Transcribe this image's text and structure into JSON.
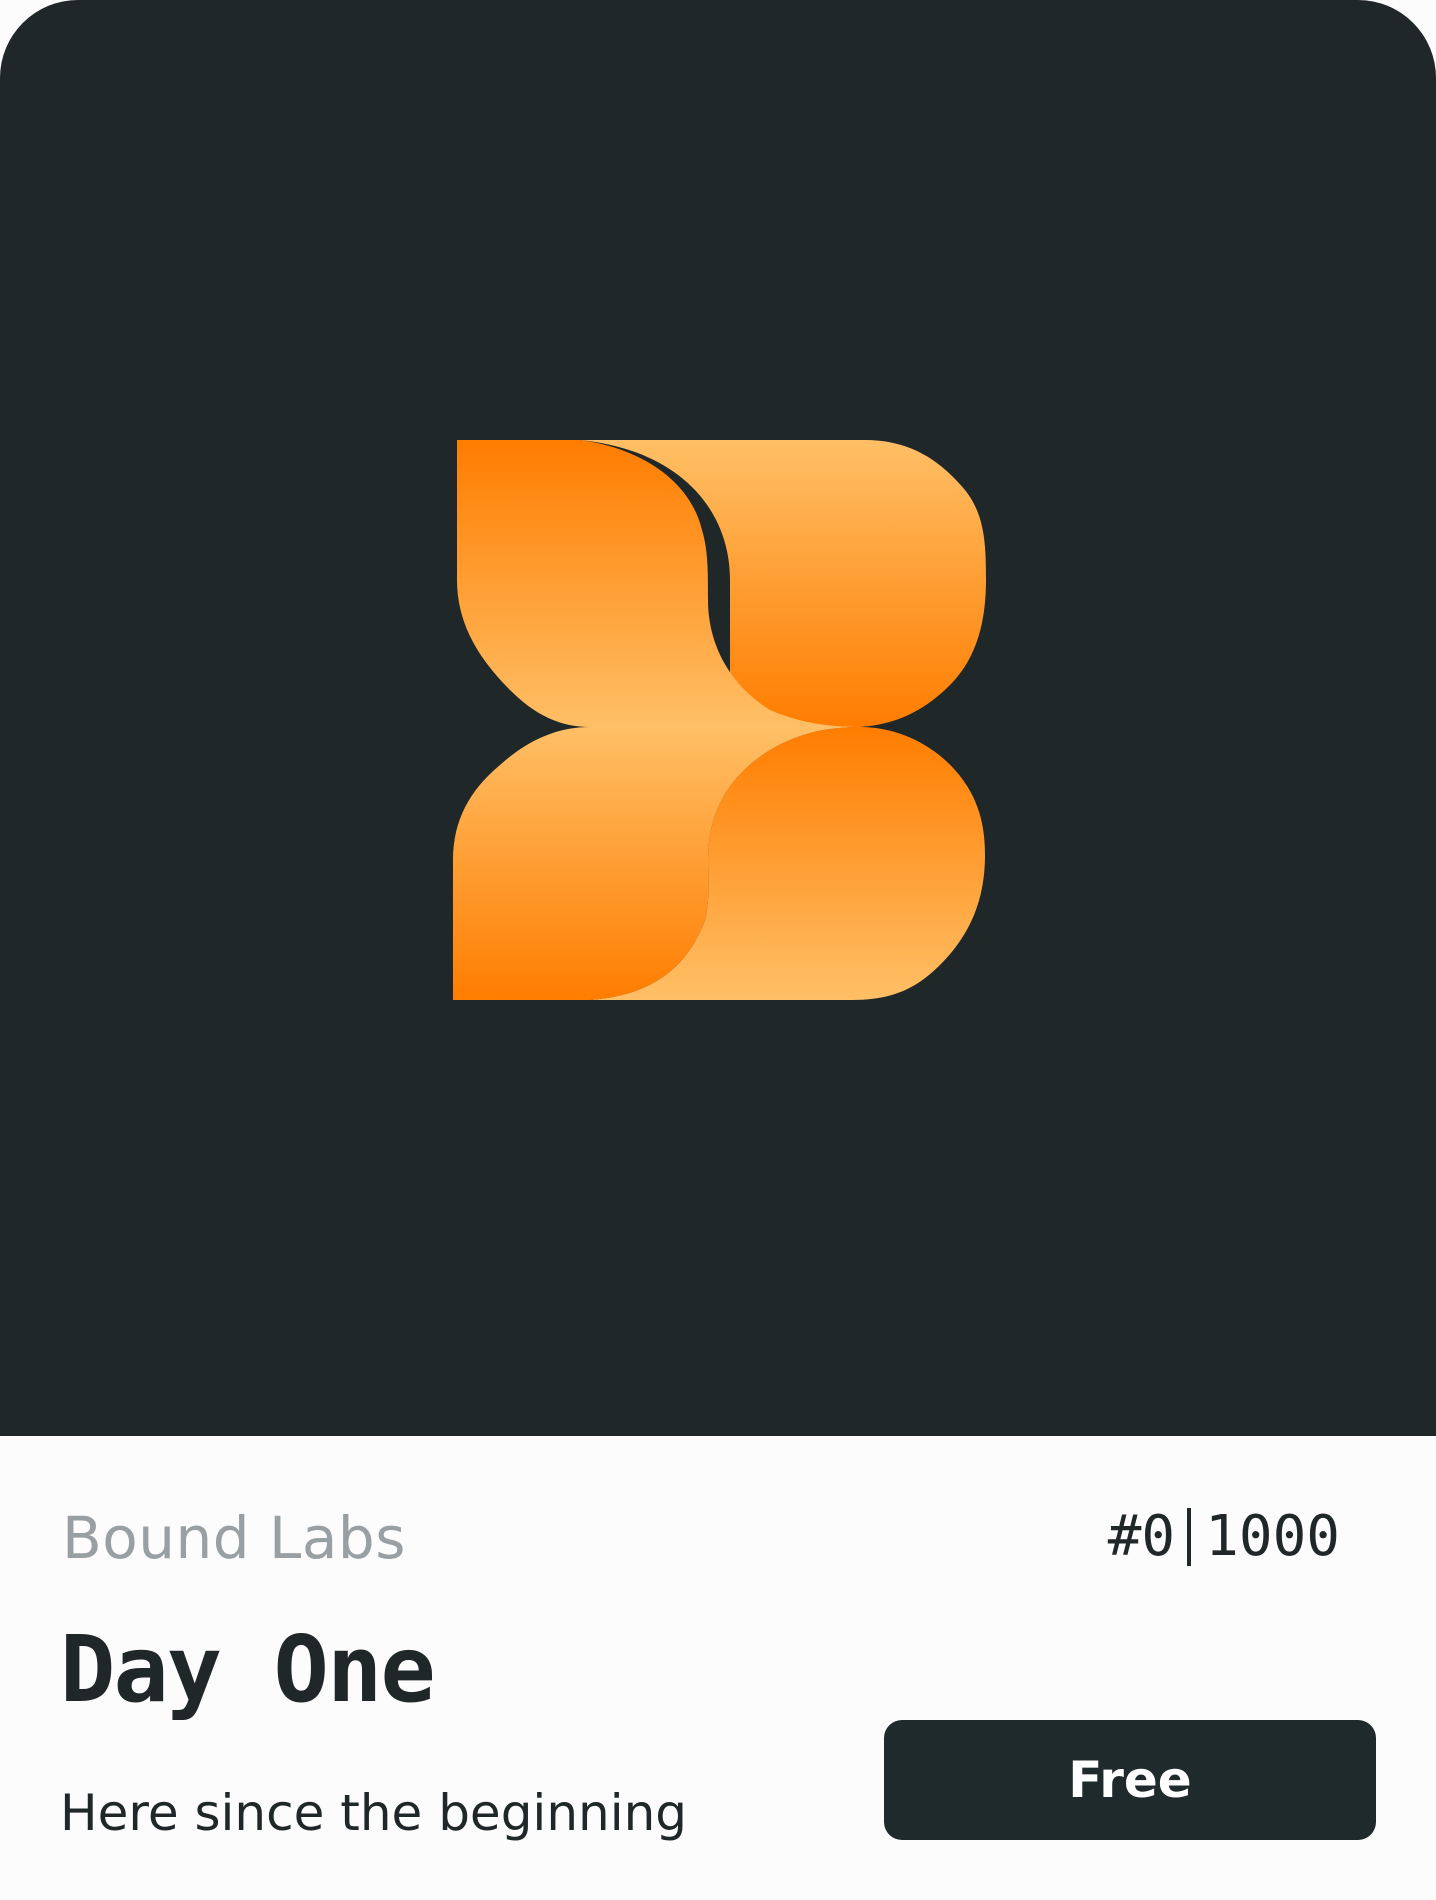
{
  "collection": {
    "name": "Bound Labs"
  },
  "edition": {
    "number": "#0",
    "supply": "1000"
  },
  "item": {
    "title": "Day One",
    "description": "Here since the beginning"
  },
  "price_button": {
    "label": "Free"
  },
  "logo": {
    "icon": "bound-labs-logo-icon"
  },
  "colors": {
    "background_dark": "#1f2729",
    "text_dark": "#1f2729",
    "text_muted": "#98a0a3",
    "accent_orange": "#ff7d00",
    "accent_light_orange": "#ffbf66"
  }
}
